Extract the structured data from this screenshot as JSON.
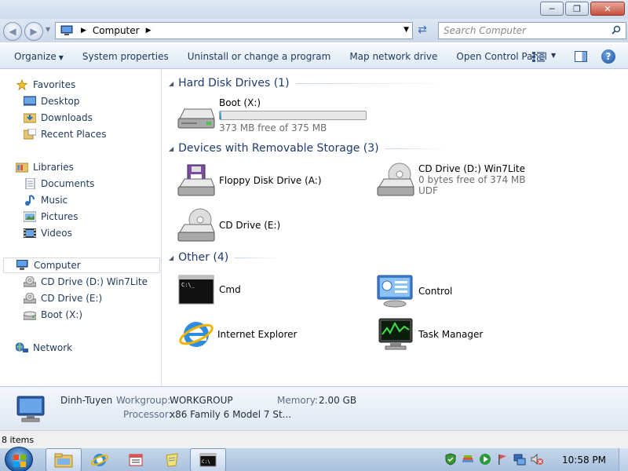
{
  "window": {
    "buttons": {
      "minimize": "─",
      "maximize": "❐",
      "close": "✕"
    }
  },
  "address": {
    "location": "Computer",
    "search_placeholder": "Search Computer"
  },
  "commands": {
    "organize": "Organize",
    "system_properties": "System properties",
    "uninstall": "Uninstall or change a program",
    "map_drive": "Map network drive",
    "control_panel": "Open Control Panel"
  },
  "nav": {
    "favorites": "Favorites",
    "desktop": "Desktop",
    "downloads": "Downloads",
    "recent_places": "Recent Places",
    "libraries": "Libraries",
    "documents": "Documents",
    "music": "Music",
    "pictures": "Pictures",
    "videos": "Videos",
    "computer": "Computer",
    "cd_d": "CD Drive (D:) Win7Lite",
    "cd_e": "CD Drive (E:)",
    "boot_x": "Boot (X:)",
    "network": "Network"
  },
  "groups": {
    "hdd": {
      "label": "Hard Disk Drives (1)",
      "boot": {
        "name": "Boot (X:)",
        "free": "373 MB free of 375 MB",
        "used_fraction": 0.005
      }
    },
    "removable": {
      "label": "Devices with Removable Storage (3)",
      "floppy": {
        "name": "Floppy Disk Drive (A:)"
      },
      "cd_d": {
        "name": "CD Drive (D:) Win7Lite",
        "free": "0 bytes free of 374 MB",
        "fs": "UDF"
      },
      "cd_e": {
        "name": "CD Drive (E:)"
      }
    },
    "other": {
      "label": "Other (4)",
      "cmd": "Cmd",
      "control": "Control",
      "ie": "Internet Explorer",
      "taskmgr": "Task Manager"
    }
  },
  "details": {
    "name": "Dinh-Tuyen",
    "workgroup_key": "Workgroup:",
    "workgroup_val": "WORKGROUP",
    "memory_key": "Memory:",
    "memory_val": "2.00 GB",
    "processor_key": "Processor:",
    "processor_val": "x86 Family 6 Model 7 St..."
  },
  "status": {
    "items": "8 items"
  },
  "taskbar": {
    "clock": "10:58 PM"
  },
  "colors": {
    "accent": "#1e395b",
    "group_header": "#1e3a6e",
    "progress": "#1e8ad6"
  }
}
